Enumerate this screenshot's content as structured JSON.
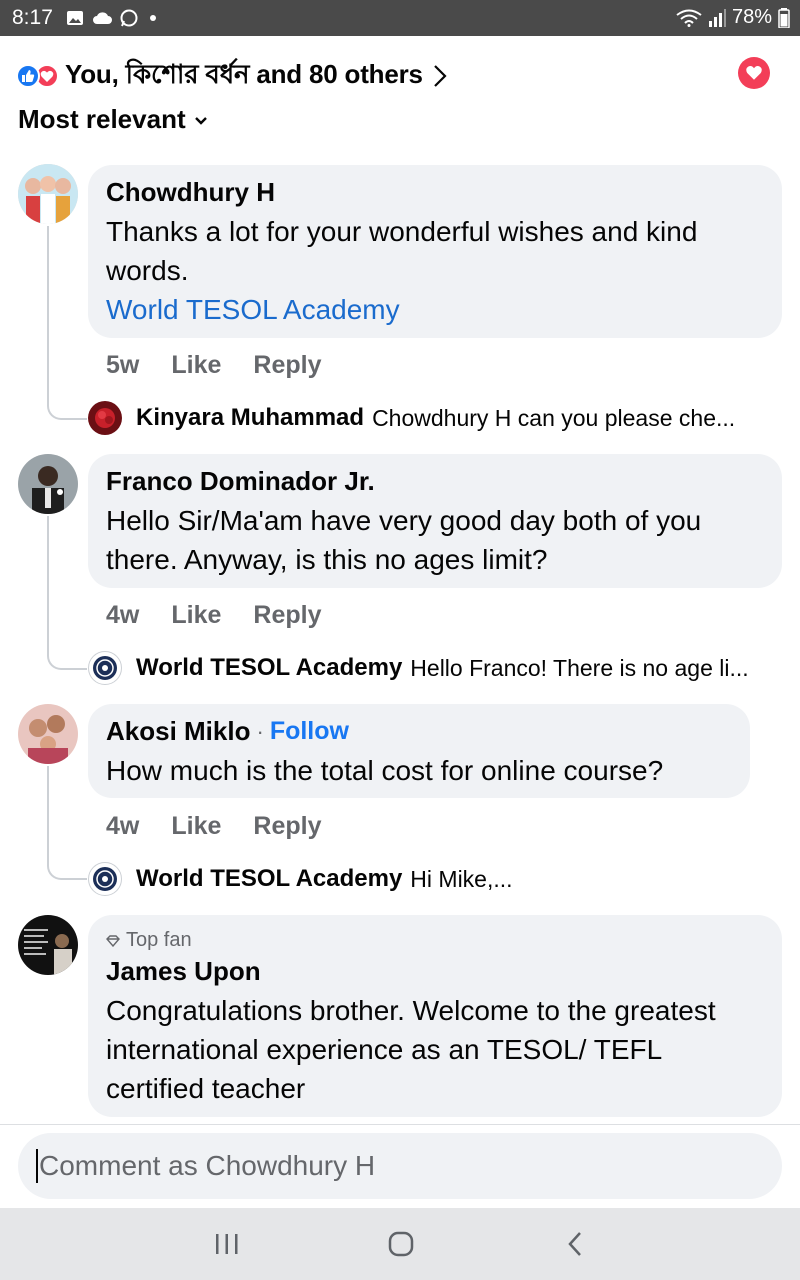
{
  "status_bar": {
    "time": "8:17",
    "battery": "78%"
  },
  "reactions": {
    "summary": "You,  কিশোর বর্ধন  and 80 others",
    "like_color": "#1877f2",
    "love_color": "#f33e58"
  },
  "sort": {
    "label": "Most relevant"
  },
  "comments": [
    {
      "author": "Chowdhury H",
      "text": "Thanks a lot for your wonderful wishes and kind words.",
      "link": "World TESOL Academy",
      "time": "5w",
      "like": "Like",
      "reply": "Reply",
      "reply_preview": {
        "author": "Kinyara Muhammad",
        "text": "Chowdhury H  can you please che..."
      }
    },
    {
      "author": "Franco Dominador Jr.",
      "text": "Hello Sir/Ma'am have very good day both of you there. Anyway, is this no ages limit?",
      "time": "4w",
      "like": "Like",
      "reply": "Reply",
      "reply_preview": {
        "author": "World TESOL Academy",
        "text": "Hello Franco! There is no age li..."
      }
    },
    {
      "author": "Akosi Miklo",
      "follow": "Follow",
      "text": "How much is the total cost for online course?",
      "time": "4w",
      "like": "Like",
      "reply": "Reply",
      "reply_preview": {
        "author": "World TESOL Academy",
        "text": "Hi Mike,..."
      }
    },
    {
      "badge": "Top fan",
      "author": "James Upon",
      "text": "Congratulations brother. Welcome to the greatest international experience as an TESOL/ TEFL certified teacher"
    }
  ],
  "composer": {
    "placeholder": "Comment as Chowdhury H"
  }
}
